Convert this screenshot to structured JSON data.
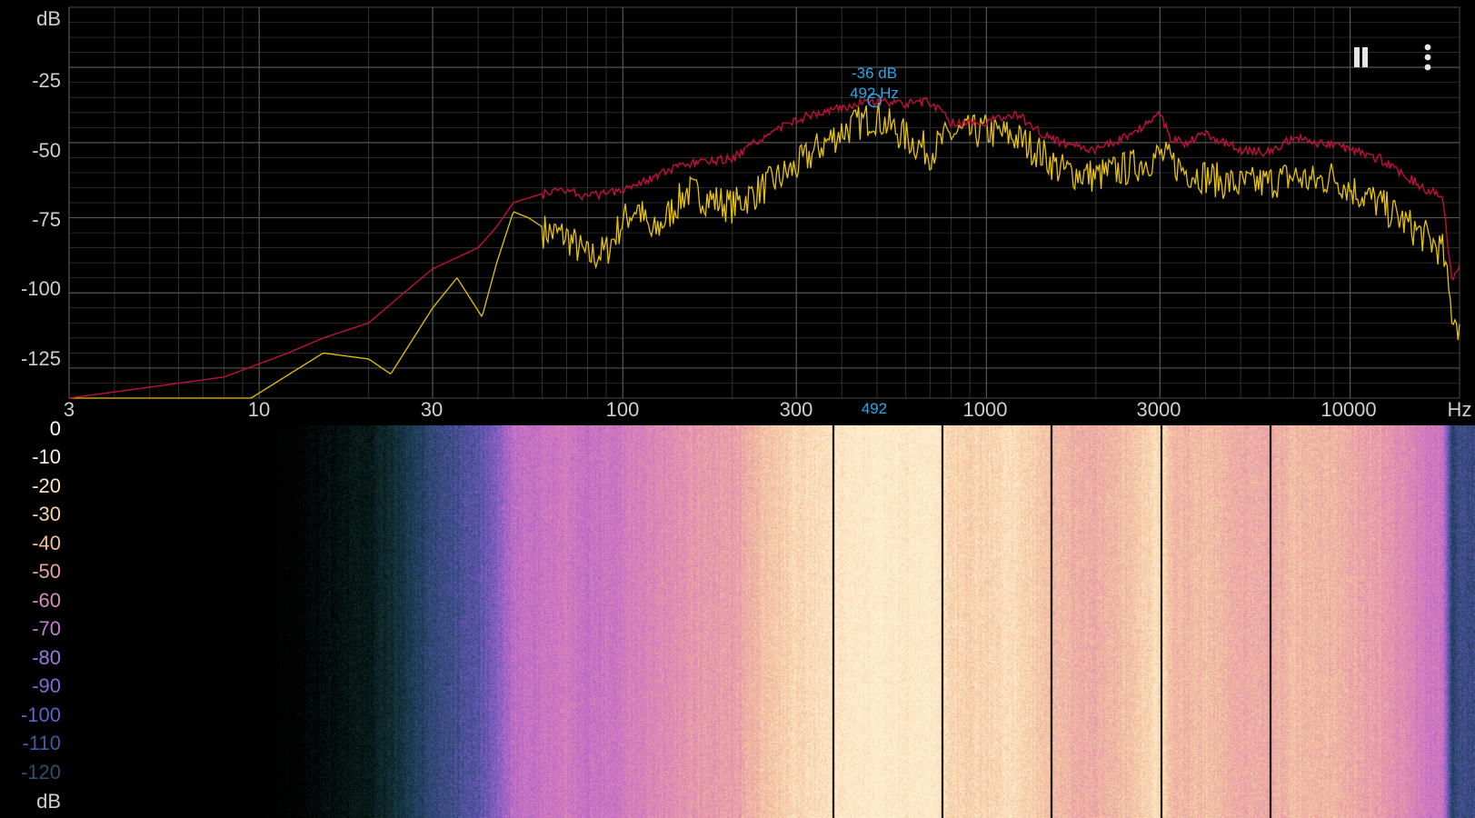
{
  "spectrum": {
    "y_unit": "dB",
    "y_ticks": [
      "-25",
      "-50",
      "-75",
      "-100",
      "-125"
    ],
    "x_ticks": [
      "3",
      "10",
      "30",
      "100",
      "300",
      "1000",
      "3000",
      "10000"
    ],
    "x_unit": "Hz",
    "cursor": {
      "db_label": "-36 dB",
      "hz_label": "492 Hz",
      "axis_label": "492",
      "freq": 492,
      "db": -36
    },
    "colors": {
      "current": "#e8c400",
      "peak_hold": "#c0103c",
      "cursor": "#2aa7e8",
      "grid": "#3a3a3a"
    }
  },
  "spectrogram": {
    "labels": [
      "0",
      "-10",
      "-20",
      "-30",
      "-40",
      "-50",
      "-60",
      "-70",
      "-80",
      "-90",
      "-100",
      "-110",
      "-120"
    ],
    "label_colors": [
      "#ffffff",
      "#fbf2e2",
      "#fbe6c4",
      "#f6d4a8",
      "#f1bc9c",
      "#ea9fa4",
      "#d58cc0",
      "#c07fd6",
      "#9b78e0",
      "#7d6fd8",
      "#5c64c4",
      "#3f5ba0",
      "#2d4f6a"
    ],
    "unit": "dB"
  },
  "controls": {
    "pause_icon": "pause-icon",
    "menu_icon": "more-vert-icon"
  },
  "chart_data": {
    "type": "line",
    "xlabel": "Hz",
    "ylabel": "dB",
    "x_scale": "log",
    "xlim": [
      3,
      20000
    ],
    "ylim": [
      -135,
      -5
    ],
    "series": [
      {
        "x": [
          3,
          9.5,
          15,
          20,
          23,
          30,
          35,
          41,
          45,
          50,
          55,
          60,
          70,
          80,
          90,
          100,
          110,
          120,
          150,
          200,
          250,
          300,
          350,
          400,
          492,
          600,
          700,
          800,
          1000,
          1200,
          1400,
          1600,
          2000,
          2500,
          3000,
          3200,
          3500,
          4000,
          4500,
          5000,
          6000,
          7000,
          8000,
          9000,
          10000,
          12000,
          14000,
          16000,
          18000,
          19000,
          20000
        ],
        "y": [
          -135,
          -135,
          -120,
          -122,
          -127,
          -105,
          -95,
          -108,
          -90,
          -73,
          -75,
          -78,
          -80,
          -87,
          -85,
          -75,
          -70,
          -80,
          -65,
          -70,
          -63,
          -57,
          -50,
          -45,
          -40,
          -47,
          -52,
          -46,
          -45,
          -47,
          -52,
          -58,
          -60,
          -57,
          -53,
          -55,
          -58,
          -60,
          -62,
          -63,
          -62,
          -60,
          -62,
          -60,
          -64,
          -69,
          -75,
          -80,
          -85,
          -105,
          -110
        ]
      },
      {
        "x": [
          3,
          8,
          12,
          15,
          20,
          25,
          30,
          40,
          45,
          50,
          60,
          70,
          80,
          100,
          150,
          200,
          250,
          300,
          400,
          492,
          600,
          700,
          800,
          1000,
          1200,
          1400,
          1600,
          2000,
          2500,
          3000,
          3200,
          3500,
          4000,
          5000,
          6000,
          7000,
          8000,
          9000,
          10000,
          12000,
          14000,
          16000,
          18000,
          19000,
          20000
        ],
        "y": [
          -135,
          -128,
          -120,
          -115,
          -110,
          -100,
          -92,
          -85,
          -78,
          -70,
          -67,
          -65,
          -68,
          -65,
          -57,
          -55,
          -47,
          -42,
          -38,
          -36,
          -37,
          -36,
          -43,
          -43,
          -40,
          -46,
          -50,
          -52,
          -47,
          -40,
          -48,
          -50,
          -47,
          -52,
          -53,
          -48,
          -50,
          -50,
          -52,
          -55,
          -60,
          -65,
          -67,
          -95,
          -90
        ]
      }
    ]
  }
}
